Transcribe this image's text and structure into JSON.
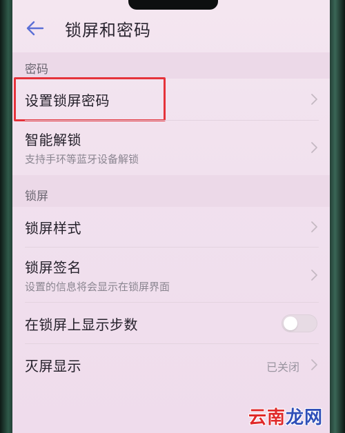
{
  "header": {
    "title": "锁屏和密码"
  },
  "sections": {
    "password": {
      "label": "密码",
      "items": [
        {
          "title": "设置锁屏密码"
        },
        {
          "title": "智能解锁",
          "subtitle": "支持手环等蓝牙设备解锁"
        }
      ]
    },
    "lockscreen": {
      "label": "锁屏",
      "items": [
        {
          "title": "锁屏样式"
        },
        {
          "title": "锁屏签名",
          "subtitle": "设置的信息将会显示在锁屏界面"
        },
        {
          "title": "在锁屏上显示步数",
          "toggle": false
        },
        {
          "title": "灭屏显示",
          "value": "已关闭"
        }
      ]
    }
  },
  "watermark": {
    "part1": "云南",
    "part2": "龙网"
  },
  "colors": {
    "highlight": "#e5323a",
    "accent": "#5b6fd6",
    "watermark_red": "#e02a2a",
    "watermark_blue": "#2f4fb8"
  },
  "icons": {
    "back": "arrow-left-icon",
    "chevron": "chevron-right-icon"
  }
}
